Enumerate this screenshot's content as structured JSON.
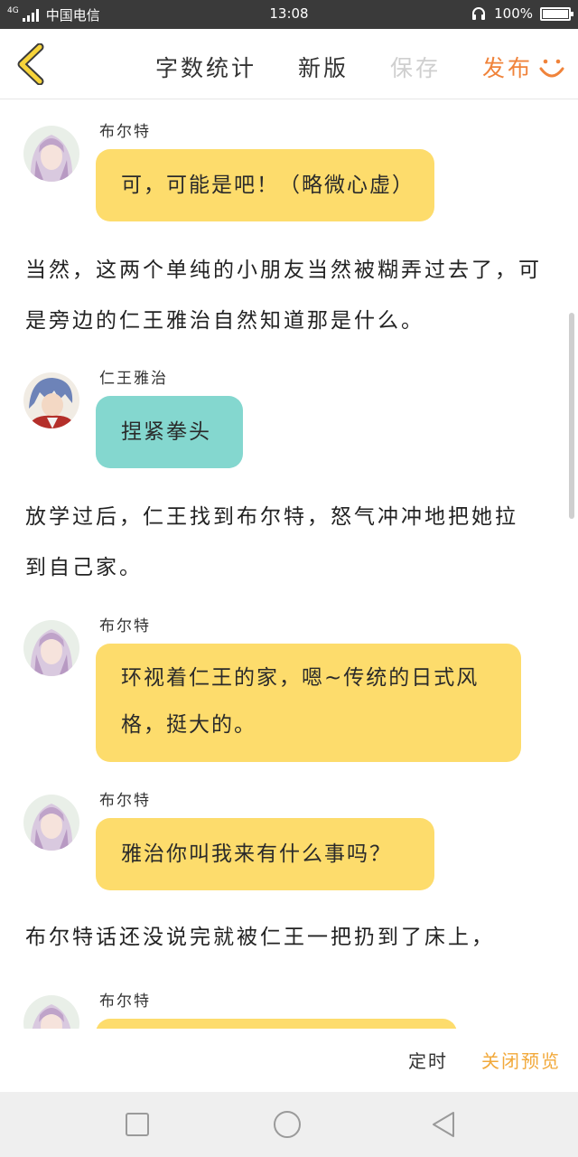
{
  "status_bar": {
    "network": "4G",
    "carrier": "中国电信",
    "time": "13:08",
    "battery": "100%",
    "icons": [
      "signal-icon",
      "headset-icon",
      "battery-icon"
    ]
  },
  "toolbar": {
    "word_count": "字数统计",
    "new_version": "新版",
    "save": "保存",
    "publish": "发布",
    "icons": [
      "back-chevron-icon",
      "smile-icon"
    ]
  },
  "messages": [
    {
      "kind": "chat",
      "speaker": "布尔特",
      "text": "可，可能是吧！（略微心虚）",
      "color": "#fddc6c"
    },
    {
      "kind": "narration",
      "lines": [
        "当然，这两个单纯的小朋友当然被糊弄过去了，可",
        "是旁边的仁王雅治自然知道那是什么。"
      ]
    },
    {
      "kind": "chat",
      "speaker": "仁王雅治",
      "text": "捏紧拳头",
      "color": "#84d7cf"
    },
    {
      "kind": "narration",
      "lines": [
        "放学过后，仁王找到布尔特，怒气冲冲地把她拉",
        "到自己家。"
      ]
    },
    {
      "kind": "chat",
      "speaker": "布尔特",
      "lines": [
        "环视着仁王的家，嗯~传统的日式风",
        "格，挺大的。"
      ],
      "color": "#fddc6c"
    },
    {
      "kind": "chat",
      "speaker": "布尔特",
      "text": "雅治你叫我来有什么事吗？",
      "color": "#fddc6c"
    },
    {
      "kind": "narration",
      "lines": [
        "布尔特话还没说完就被仁王一把扔到了床上，"
      ]
    },
    {
      "kind": "chat",
      "speaker": "布尔特",
      "text": "",
      "color": "#fddc6c"
    }
  ],
  "bottom_actions": {
    "timer": "定时",
    "close_preview": "关闭预览"
  },
  "nav_bar": {
    "icons": [
      "square-recent-icon",
      "circle-home-icon",
      "triangle-back-icon"
    ]
  }
}
